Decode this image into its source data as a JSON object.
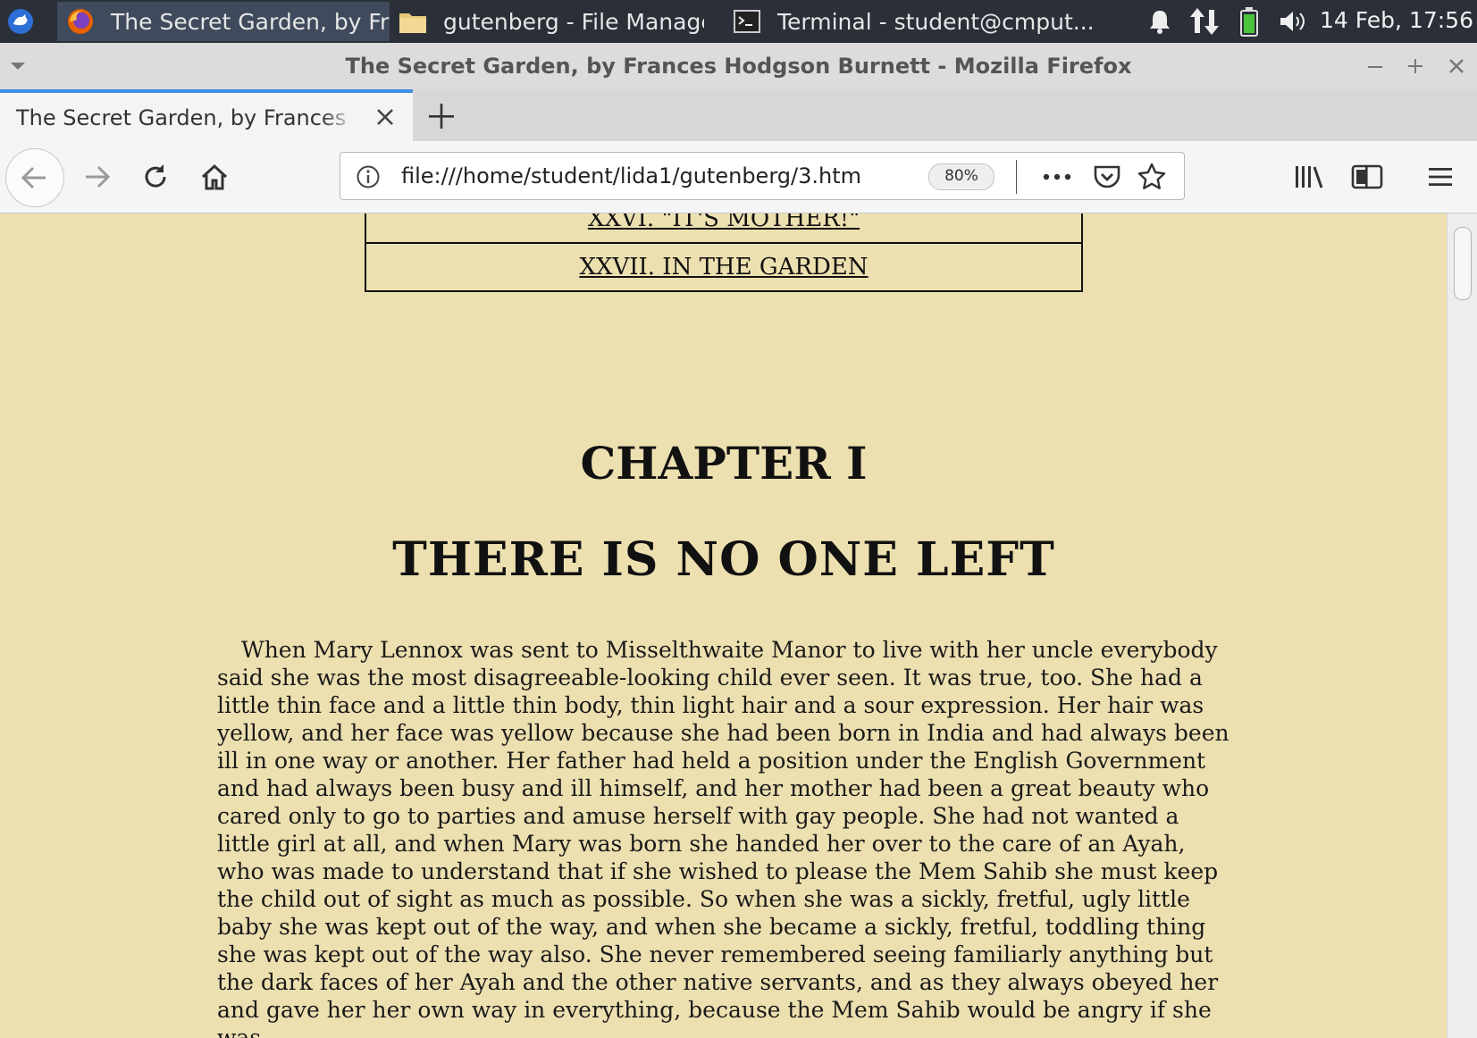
{
  "taskbar": {
    "tasks": [
      {
        "label": "The Secret Garden, by Fran...",
        "icon": "firefox-icon"
      },
      {
        "label": "gutenberg - File Manager",
        "icon": "folder-icon"
      },
      {
        "label": "Terminal - student@cmput...",
        "icon": "terminal-icon"
      }
    ],
    "clock": "14 Feb, 17:56"
  },
  "window": {
    "title": "The Secret Garden, by Frances Hodgson Burnett - Mozilla Firefox"
  },
  "browser": {
    "tab_title": "The Secret Garden, by Frances Hodgson Burnett",
    "url": "file:///home/student/lida1/gutenberg/3.htm",
    "zoom": "80%"
  },
  "page": {
    "toc": [
      {
        "label": "XXVI. \"IT'S MOTHER!\""
      },
      {
        "label": "XXVII. IN THE GARDEN"
      }
    ],
    "chapter_number": "CHAPTER I",
    "chapter_title": "THERE IS NO ONE LEFT",
    "paragraph": "When Mary Lennox was sent to Misselthwaite Manor to live with her uncle everybody said she was the most disagreeable-looking child ever seen. It was true, too. She had a little thin face and a little thin body, thin light hair and a sour expression. Her hair was yellow, and her face was yellow because she had been born in India and had always been ill in one way or another. Her father had held a position under the English Government and had always been busy and ill himself, and her mother had been a great beauty who cared only to go to parties and amuse herself with gay people. She had not wanted a little girl at all, and when Mary was born she handed her over to the care of an Ayah, who was made to understand that if she wished to please the Mem Sahib she must keep the child out of sight as much as possible. So when she was a sickly, fretful, ugly little baby she was kept out of the way, and when she became a sickly, fretful, toddling thing she was kept out of the way also. She never remembered seeing familiarly anything but the dark faces of her Ayah and the other native servants, and as they always obeyed her and gave her her own way in everything, because the Mem Sahib would be angry if she was"
  },
  "colors": {
    "page_background": "#ede0b0",
    "taskbar": "#2a2f38",
    "tab_accent": "#3d8ee3"
  }
}
